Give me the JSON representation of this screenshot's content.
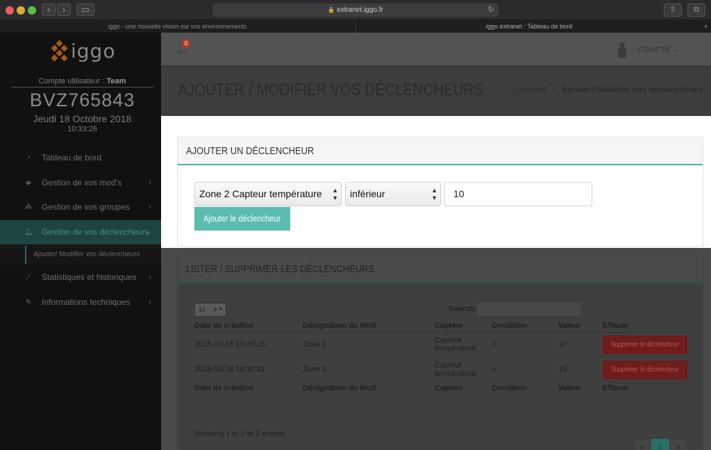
{
  "browser": {
    "url": "extranet.iggo.fr",
    "tabs": [
      "iggo - une nouvelle vision sur vos environnements",
      "iggo.extranet : Tableau de bord"
    ]
  },
  "sidebar": {
    "logo_text": "iggo",
    "account_label": "Compte utilisateur : ",
    "account_name": "Team",
    "account_id": "BVZ765843",
    "date": "Jeudi 18 Octobre 2018",
    "time": "10:33:26",
    "items": [
      {
        "label": "Tableau de bord",
        "icon": "dashboard-icon"
      },
      {
        "label": "Gestion de vos mod's",
        "icon": "cube-icon"
      },
      {
        "label": "Gestion de vos groupes",
        "icon": "cubes-icon"
      },
      {
        "label": "Gestion de vos déclencheurs",
        "icon": "bell-icon"
      },
      {
        "label": "Statistiques et historiques",
        "icon": "chart-icon"
      },
      {
        "label": "Informations techniques",
        "icon": "wrench-icon"
      }
    ],
    "subitem": "Ajouter/ Modifier vos déclencheurs"
  },
  "topbar": {
    "notification_count": "0",
    "account_menu": "COMPTE"
  },
  "page": {
    "title": "AJOUTER / MODIFIER VOS DÉCLENCHEURS",
    "breadcrumb_home": "Accueil",
    "breadcrumb_current": "Ajouter / Modifier vos déclencheurs"
  },
  "add_panel": {
    "heading": "AJOUTER UN DÉCLENCHEUR",
    "sensor_value": "Zone 2 Capteur température",
    "condition_value": "inférieur",
    "threshold_value": "10",
    "submit_label": "Ajouter le déclencheur"
  },
  "list_panel": {
    "heading": "LISTER / SUPPRIMER LES DÉCLENCHEURS",
    "page_size": "10",
    "search_label": "Search:",
    "columns": [
      "Date de création",
      "Désignation du Mod",
      "Capteur",
      "Condition",
      "Valeur",
      "Effacer"
    ],
    "rows": [
      {
        "date": "2018-10-18 10:30:16",
        "mod": "Zone 1",
        "sensor": "Capteur température",
        "condition": "<",
        "value": "10",
        "action": "Supprimer le déclencheur"
      },
      {
        "date": "2018-10-18 10:30:21",
        "mod": "Zone 2",
        "sensor": "Capteur température",
        "condition": "<",
        "value": "10",
        "action": "Supprimer le déclencheur"
      }
    ],
    "showing": "Showing 1 to 2 of 2 entries",
    "pager": {
      "prev": "«",
      "current": "1",
      "next": "»"
    }
  },
  "colors": {
    "accent": "#5bbcb0",
    "sidebar_bg": "#111111",
    "danger": "#c0392b"
  }
}
